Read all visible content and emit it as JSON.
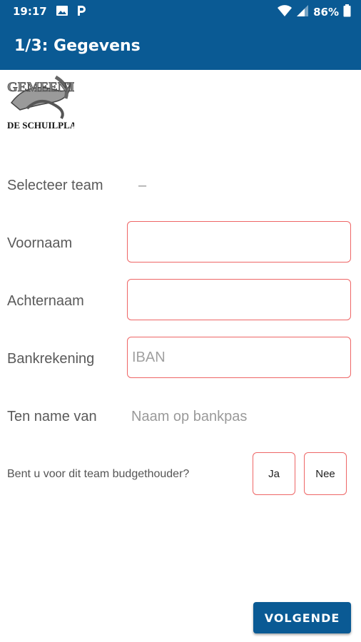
{
  "status_bar": {
    "time": "19:17",
    "battery": "86%",
    "icons": [
      "image-icon",
      "parking-icon",
      "wifi-icon",
      "signal-icon",
      "battery-icon"
    ]
  },
  "app_bar": {
    "title": "1/3: Gegevens"
  },
  "logo": {
    "line1": "GEMEENTE",
    "line2": "DE SCHUILPLAATS"
  },
  "form": {
    "team": {
      "label": "Selecteer team",
      "value": "–"
    },
    "first_name": {
      "label": "Voornaam",
      "value": "",
      "placeholder": ""
    },
    "last_name": {
      "label": "Achternaam",
      "value": "",
      "placeholder": ""
    },
    "bank": {
      "label": "Bankrekening",
      "value": "",
      "placeholder": "IBAN"
    },
    "holder": {
      "label": "Ten name van",
      "placeholder": "Naam op bankpas"
    },
    "budget_question": "Bent u voor dit team budgethouder?",
    "yes_label": "Ja",
    "no_label": "Nee"
  },
  "footer": {
    "next_label": "VOLGENDE"
  },
  "colors": {
    "primary": "#0a5a94",
    "field_border": "#ee6666"
  }
}
